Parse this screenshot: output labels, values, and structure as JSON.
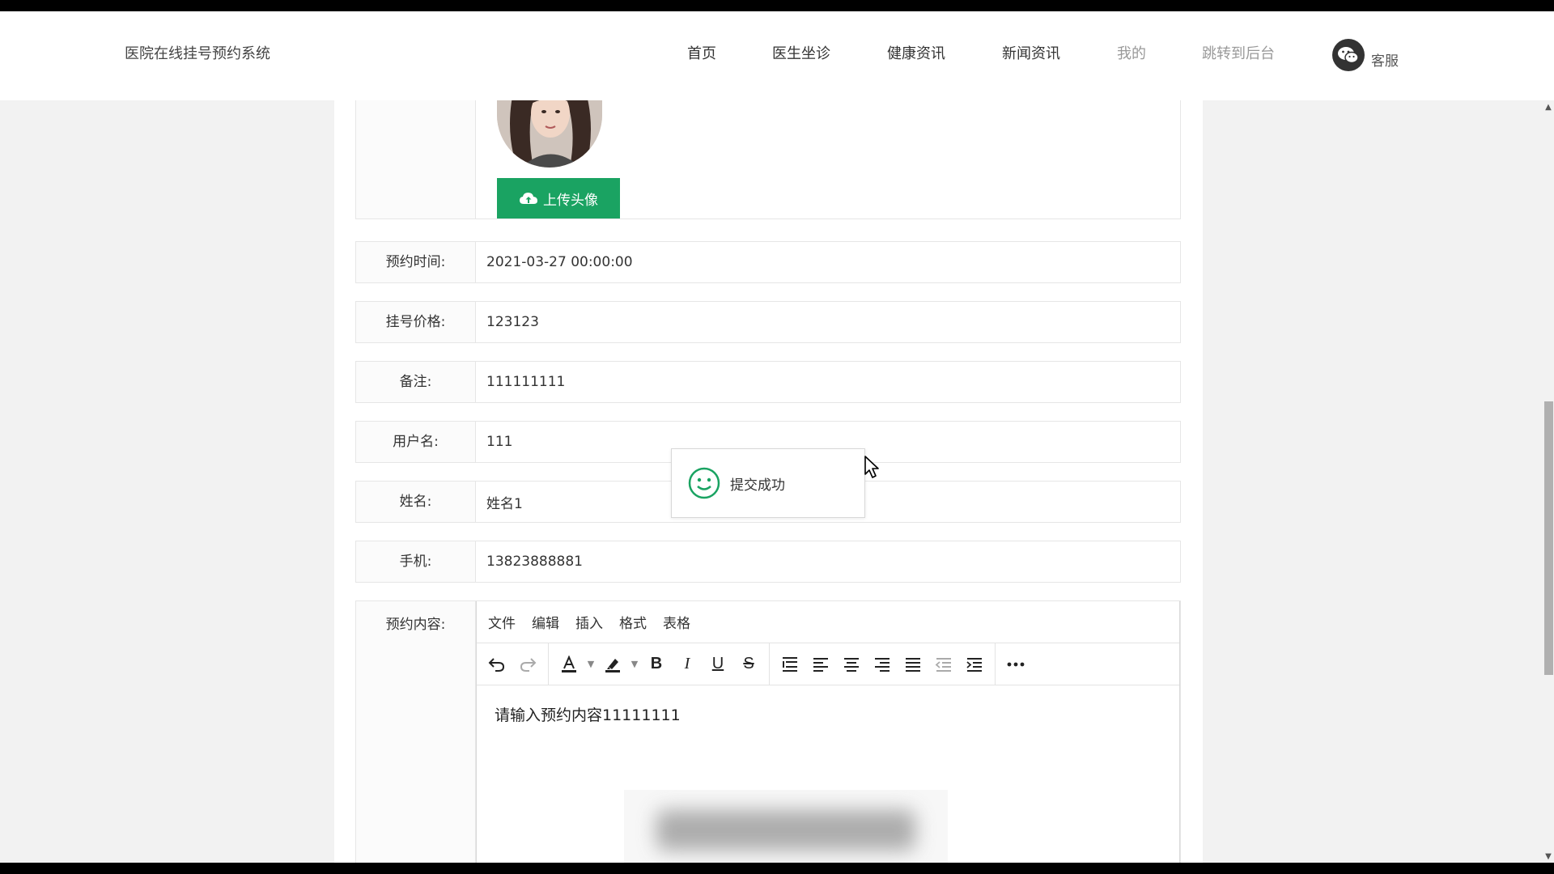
{
  "header": {
    "brand": "医院在线挂号预约系统",
    "nav": [
      {
        "label": "首页"
      },
      {
        "label": "医生坐诊"
      },
      {
        "label": "健康资讯"
      },
      {
        "label": "新闻资讯"
      },
      {
        "label": "我的"
      },
      {
        "label": "跳转到后台"
      }
    ],
    "service_label": "客服"
  },
  "avatar": {
    "upload_label": "上传头像"
  },
  "form": {
    "fields": [
      {
        "label": "预约时间:",
        "value": "2021-03-27 00:00:00"
      },
      {
        "label": "挂号价格:",
        "value": "123123"
      },
      {
        "label": "备注:",
        "value": "111111111"
      },
      {
        "label": "用户名:",
        "value": "111"
      },
      {
        "label": "姓名:",
        "value": "姓名1"
      },
      {
        "label": "手机:",
        "value": "13823888881"
      }
    ],
    "content_label": "预约内容:"
  },
  "editor": {
    "menu": [
      "文件",
      "编辑",
      "插入",
      "格式",
      "表格"
    ],
    "body": "请输入预约内容11111111",
    "icons": [
      "undo-icon",
      "redo-icon",
      "font-color-icon",
      "highlight-icon",
      "bold-icon",
      "italic-icon",
      "underline-icon",
      "strikethrough-icon",
      "line-height-icon",
      "align-left-icon",
      "align-center-icon",
      "align-right-icon",
      "align-justify-icon",
      "outdent-icon",
      "indent-icon",
      "more-icon"
    ]
  },
  "toast": {
    "text": "提交成功",
    "icon": "smile-icon"
  },
  "colors": {
    "accent": "#1aa362",
    "muted_nav": "#999999"
  }
}
